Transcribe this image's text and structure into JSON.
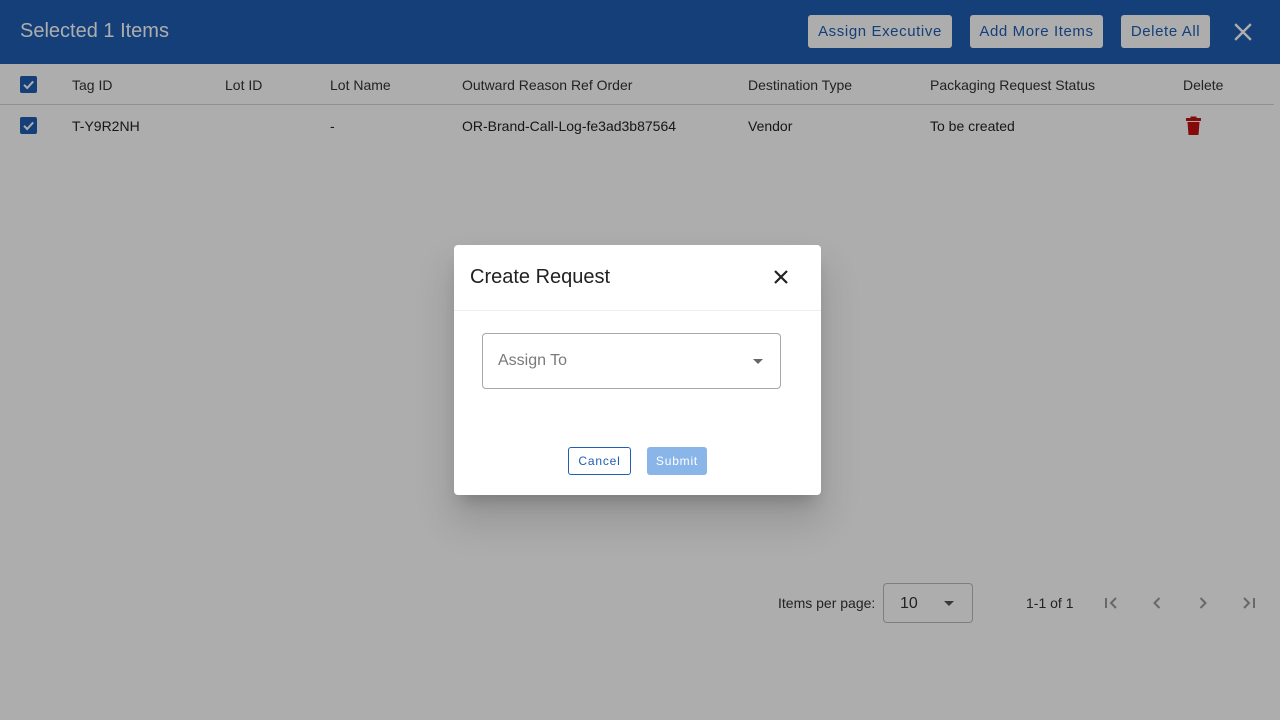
{
  "header": {
    "title": "Selected 1 Items",
    "assign_executive_label": "Assign Executive",
    "add_more_items_label": "Add More Items",
    "delete_all_label": "Delete All",
    "close_icon": "close-icon",
    "background_color": "#1e5eb3"
  },
  "table": {
    "columns": [
      "Tag ID",
      "Lot ID",
      "Lot Name",
      "Outward Reason Ref Order",
      "Destination Type",
      "Packaging Request Status",
      "Delete"
    ],
    "rows": [
      {
        "checked": true,
        "tag_id": "T-Y9R2NH",
        "lot_id": "",
        "lot_name": "-",
        "outward_reason_ref_order": "OR-Brand-Call-Log-fe3ad3b87564",
        "destination_type": "Vendor",
        "packaging_request_status": "To be created",
        "delete_icon": "trash-icon"
      }
    ]
  },
  "paginator": {
    "items_per_page_label": "Items per page:",
    "items_per_page_value": "10",
    "range_label": "1-1 of 1"
  },
  "dialog": {
    "title": "Create Request",
    "assign_to_placeholder": "Assign To",
    "cancel_label": "Cancel",
    "submit_label": "Submit"
  },
  "colors": {
    "primary": "#1e5eb3",
    "delete_red": "#c41010",
    "submit_disabled": "#8ab5e8"
  }
}
